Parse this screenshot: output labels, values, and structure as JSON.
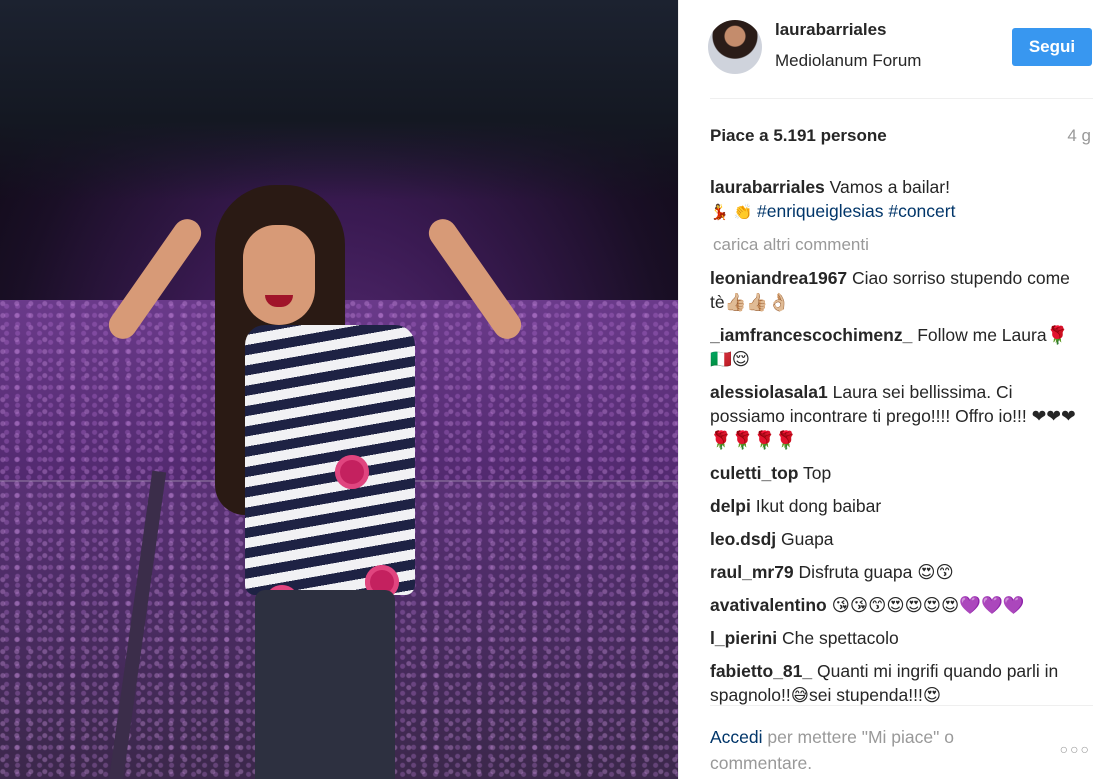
{
  "post": {
    "username": "laurabarriales",
    "location": "Mediolanum Forum",
    "follow_label": "Segui",
    "likes_text": "Piace a 5.191 persone",
    "age": "4 g"
  },
  "caption": {
    "username": "laurabarriales",
    "text": "Vamos a bailar!",
    "emojis": "💃 👏",
    "hashtags": "#enriqueiglesias #concert"
  },
  "load_more_label": "carica altri commenti",
  "comments": [
    {
      "username": "leoniandrea1967",
      "text": "Ciao sorriso stupendo come tè👍🏼👍🏼👌🏼"
    },
    {
      "username": "_iamfrancescochimenz_",
      "text": "Follow me Laura🌹🇮🇹😌"
    },
    {
      "username": "alessiolasala1",
      "text": "Laura sei bellissima. Ci possiamo incontrare ti prego!!!! Offro io!!! ❤❤❤🌹🌹🌹🌹"
    },
    {
      "username": "culetti_top",
      "text": "Top"
    },
    {
      "username": "delpi",
      "text": "Ikut dong baibar"
    },
    {
      "username": "leo.dsdj",
      "text": "Guapa"
    },
    {
      "username": "raul_mr79",
      "text": "Disfruta guapa 😍😙"
    },
    {
      "username": "avativalentino",
      "text": "😘😘😙😍😍😍😍💜💜💜"
    },
    {
      "username": "l_pierini",
      "text": "Che spettacolo"
    },
    {
      "username": "fabietto_81_",
      "text": "Quanti mi ingrifi quando parli in spagnolo!!😅sei stupenda!!!😍"
    }
  ],
  "footer": {
    "login_label": "Accedi",
    "rest_text": "per mettere \"Mi piace\" o commentare.",
    "more_icon": "more-options-icon"
  },
  "colors": {
    "follow_button": "#3897f0",
    "link": "#003569",
    "muted": "#999999"
  }
}
